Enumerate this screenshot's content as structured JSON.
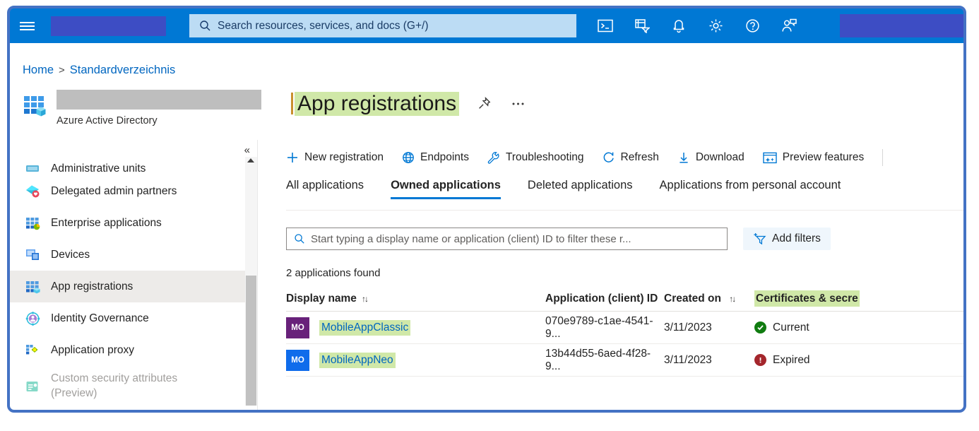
{
  "colors": {
    "azure_blue": "#0078D4",
    "link_blue": "#0066C0",
    "annotation_border": "#4472C4",
    "highlight_green": "#D0E8A8",
    "redaction_purple": "#3D4DC4",
    "redaction_grey": "#BEBEBE",
    "status_ok_green": "#107C10",
    "status_bad_red": "#A4262C",
    "avatar_purple": "#68217A",
    "avatar_blue": "#0F6CEB"
  },
  "topbar": {
    "menu_icon": "hamburger-icon",
    "logo_redacted": true,
    "search": {
      "icon": "search-icon",
      "placeholder": "Search resources, services, and docs (G+/)",
      "value": ""
    },
    "icons": [
      {
        "name": "cloud-shell-icon",
        "label": "Cloud Shell"
      },
      {
        "name": "directories-subscriptions-icon",
        "label": "Directories + subscriptions"
      },
      {
        "name": "notifications-bell-icon",
        "label": "Notifications"
      },
      {
        "name": "settings-gear-icon",
        "label": "Settings"
      },
      {
        "name": "help-question-icon",
        "label": "Help"
      },
      {
        "name": "feedback-person-icon",
        "label": "Feedback"
      }
    ],
    "account_redacted": true
  },
  "breadcrumb": {
    "items": [
      {
        "label": "Home"
      },
      {
        "label": "Standardverzeichnis"
      }
    ],
    "separator": ">"
  },
  "header": {
    "logo_icon": "azure-active-directory-icon",
    "tenant_redacted": true,
    "subtitle": "Azure Active Directory",
    "title": "App registrations",
    "title_highlighted": true,
    "pin_icon": "pin-icon",
    "more_icon": "ellipsis-icon"
  },
  "sidebar": {
    "collapse_icon": "chevron-double-left-icon",
    "items": [
      {
        "label": "Administrative units",
        "icon": "administrative-units-icon",
        "state": "clipped"
      },
      {
        "label": "Delegated admin partners",
        "icon": "delegated-admin-partners-icon",
        "state": "normal"
      },
      {
        "label": "Enterprise applications",
        "icon": "enterprise-applications-icon",
        "state": "normal"
      },
      {
        "label": "Devices",
        "icon": "devices-icon",
        "state": "normal"
      },
      {
        "label": "App registrations",
        "icon": "app-registrations-icon",
        "state": "selected"
      },
      {
        "label": "Identity Governance",
        "icon": "identity-governance-icon",
        "state": "normal"
      },
      {
        "label": "Application proxy",
        "icon": "application-proxy-icon",
        "state": "normal"
      },
      {
        "label": "Custom security attributes",
        "label2": "(Preview)",
        "icon": "custom-security-attributes-icon",
        "state": "disabled"
      }
    ],
    "scrollbar": {
      "up_arrow": "scroll-up-arrow"
    }
  },
  "toolbar": {
    "buttons": [
      {
        "label": "New registration",
        "icon": "plus-icon"
      },
      {
        "label": "Endpoints",
        "icon": "globe-icon"
      },
      {
        "label": "Troubleshooting",
        "icon": "wrench-icon"
      },
      {
        "label": "Refresh",
        "icon": "refresh-icon"
      },
      {
        "label": "Download",
        "icon": "download-arrow-icon"
      },
      {
        "label": "Preview features",
        "icon": "preview-features-icon"
      }
    ]
  },
  "tabs": [
    {
      "label": "All applications",
      "active": false
    },
    {
      "label": "Owned applications",
      "active": true
    },
    {
      "label": "Deleted applications",
      "active": false
    },
    {
      "label": "Applications from personal account",
      "active": false
    }
  ],
  "filter": {
    "search_icon": "search-icon",
    "placeholder": "Start typing a display name or application (client) ID to filter these r...",
    "value": "",
    "add_filters_label": "Add filters",
    "add_filters_icon": "add-filter-icon"
  },
  "results": {
    "count_text": "2 applications found",
    "columns": [
      {
        "key": "display_name",
        "label": "Display name",
        "sortable": true
      },
      {
        "key": "client_id",
        "label": "Application (client) ID",
        "sortable": false
      },
      {
        "key": "created_on",
        "label": "Created on",
        "sortable": true
      },
      {
        "key": "certificates",
        "label": "Certificates & secre",
        "sortable": false,
        "highlighted": true,
        "clipped": true
      }
    ],
    "rows": [
      {
        "avatar_initials": "MO",
        "avatar_color": "#68217A",
        "display_name": "MobileAppClassic",
        "client_id": "070e9789-c1ae-4541-9...",
        "created_on": "3/11/2023",
        "status_label": "Current",
        "status_kind": "ok"
      },
      {
        "avatar_initials": "MO",
        "avatar_color": "#0F6CEB",
        "display_name": "MobileAppNeo",
        "client_id": "13b44d55-6aed-4f28-9...",
        "created_on": "3/11/2023",
        "status_label": "Expired",
        "status_kind": "bad"
      }
    ]
  }
}
